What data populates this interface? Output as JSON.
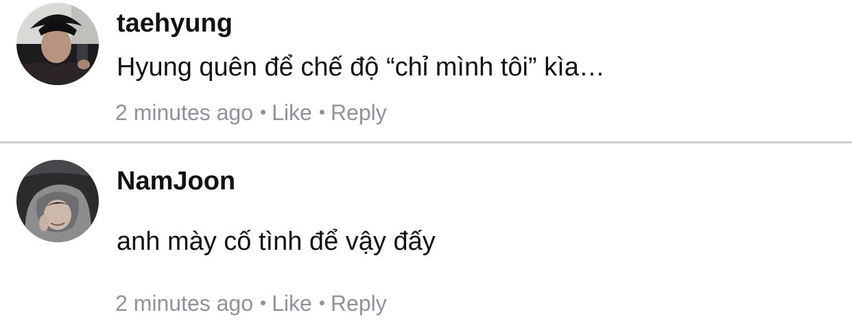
{
  "comments": [
    {
      "username": "taehyung",
      "text": "Hyung quên để chế độ “chỉ mình tôi” kìa…",
      "time": "2 minutes ago",
      "like_label": "Like",
      "reply_label": "Reply",
      "separator": "•"
    },
    {
      "username": "NamJoon",
      "text": "anh mày cố tình để vậy đấy",
      "time": "2 minutes ago",
      "like_label": "Like",
      "reply_label": "Reply",
      "separator": "•"
    }
  ],
  "colors": {
    "meta_text": "#8e929a",
    "divider": "#c9ccd1",
    "primary_text": "#111111"
  }
}
